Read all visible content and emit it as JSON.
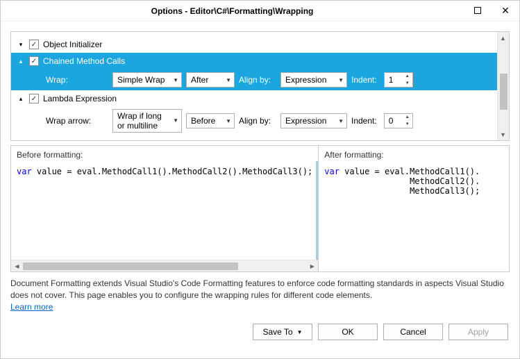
{
  "window": {
    "title": "Options - Editor\\C#\\Formatting\\Wrapping"
  },
  "tree": {
    "node0": {
      "label": "Object Initializer"
    },
    "node1": {
      "label": "Chained Method Calls"
    },
    "node1_controls": {
      "wrap_label": "Wrap:",
      "wrap_value": "Simple Wrap",
      "position_value": "After",
      "align_label": "Align by:",
      "align_value": "Expression",
      "indent_label": "Indent:",
      "indent_value": "1"
    },
    "node2": {
      "label": "Lambda Expression"
    },
    "node2_controls": {
      "wrap_label": "Wrap arrow:",
      "wrap_value": "Wrap if long or multiline",
      "position_value": "Before",
      "align_label": "Align by:",
      "align_value": "Expression",
      "indent_label": "Indent:",
      "indent_value": "0"
    }
  },
  "preview": {
    "before_header": "Before formatting:",
    "after_header": "After formatting:",
    "before_kw": "var",
    "before_rest": " value = eval.MethodCall1().MethodCall2().MethodCall3();",
    "after_kw": "var",
    "after_line1": " value = eval.MethodCall1().",
    "after_line2": "                 MethodCall2().",
    "after_line3": "                 MethodCall3();"
  },
  "description": {
    "text": "Document Formatting extends Visual Studio's Code Formatting features to enforce code formatting standards in aspects Visual Studio does not cover. This page enables you to configure the wrapping rules for different code elements.",
    "link": "Learn more"
  },
  "buttons": {
    "save_to": "Save To",
    "ok": "OK",
    "cancel": "Cancel",
    "apply": "Apply"
  }
}
